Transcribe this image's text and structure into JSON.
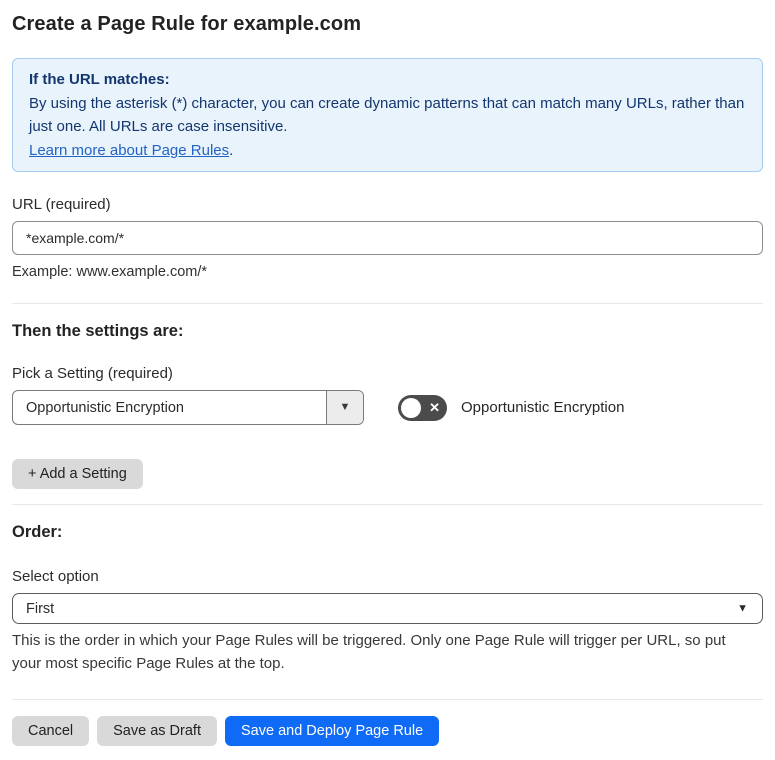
{
  "page": {
    "title": "Create a Page Rule for example.com"
  },
  "info_box": {
    "heading": "If the URL matches:",
    "body": "By using the asterisk (*) character, you can create dynamic patterns that can match many URLs, rather than just one. All URLs are case insensitive.",
    "link_label": "Learn more about Page Rules",
    "link_suffix": "."
  },
  "url_section": {
    "label": "URL (required)",
    "input_value": "*example.com/*",
    "helper": "Example: www.example.com/*"
  },
  "settings_section": {
    "heading": "Then the settings are:",
    "picker_label": "Pick a Setting (required)",
    "picker_value": "Opportunistic Encryption",
    "toggle_state": "off",
    "toggle_label": "Opportunistic Encryption",
    "add_button_label": "+ Add a Setting"
  },
  "order_section": {
    "heading": "Order:",
    "select_label": "Select option",
    "select_value": "First",
    "helper": "This is the order in which your Page Rules will be triggered. Only one Page Rule will trigger per URL, so put your most specific Page Rules at the top."
  },
  "footer": {
    "cancel_label": "Cancel",
    "save_draft_label": "Save as Draft",
    "save_deploy_label": "Save and Deploy Page Rule"
  },
  "icons": {
    "combo_arrow": "▼",
    "select_arrow": "▼",
    "toggle_off_x": "✕"
  },
  "colors": {
    "primary_button_blue": "#0f6bf5",
    "info_background": "#e9f3fc",
    "info_border": "#a5cdf2",
    "info_text_navy": "#14366f",
    "link_blue": "#2263c4",
    "toggle_off_gray": "#4b4b4b",
    "secondary_button_gray": "#d9d9d9"
  }
}
